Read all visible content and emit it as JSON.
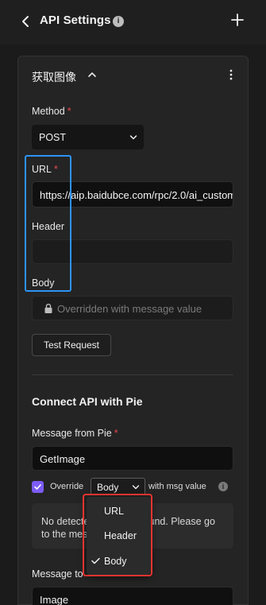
{
  "header": {
    "title": "API Settings",
    "info_glyph": "i",
    "back_icon": "chevron-left-icon",
    "add_icon": "plus-icon"
  },
  "section": {
    "title": "获取图像",
    "method": {
      "label": "Method",
      "required_mark": "*",
      "value": "POST"
    },
    "url": {
      "label": "URL",
      "required_mark": "*",
      "value": "https://aip.baidubce.com/rpc/2.0/ai_custom"
    },
    "header_field": {
      "label": "Header",
      "value": ""
    },
    "body": {
      "label": "Body",
      "placeholder": "Overridden with message value"
    },
    "test_button": "Test Request"
  },
  "connect": {
    "title": "Connect API with Pie",
    "message_from": {
      "label": "Message from Pie",
      "required_mark": "*",
      "value": "GetImage"
    },
    "override": {
      "checked": true,
      "prefix": "Override",
      "selected": "Body",
      "suffix": "with msg value",
      "info_glyph": "i"
    },
    "notice": "No detected message found. Please go to the message.",
    "message_to": {
      "label": "Message to",
      "value": "Image"
    }
  },
  "dropdown": {
    "options": [
      "URL",
      "Header",
      "Body"
    ],
    "selected": "Body"
  },
  "colors": {
    "accent": "#7c5cf4",
    "required": "#e5484d",
    "highlight_blue": "#2e93f5",
    "highlight_red": "#e3342f"
  }
}
